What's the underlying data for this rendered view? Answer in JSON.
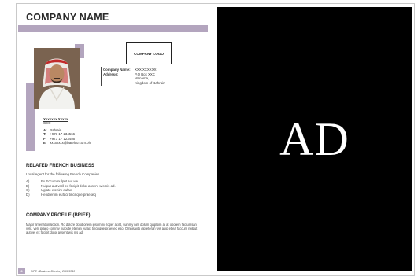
{
  "left_page": {
    "company_name": "COMPANY NAME",
    "logo_label": "COMPANY LOGO",
    "company_info": {
      "company_name_label": "Company Name:",
      "company_name_value": "XXX XXXXXX",
      "address_label": "Address:",
      "address_lines": [
        "P.O Box XXX",
        "Manama,",
        "Kingdom of Bahrain"
      ]
    },
    "contact": {
      "name": "Xxxxxxx Xxxxx",
      "title": "CEO",
      "rows": [
        {
          "key": "A:",
          "value": "Bahrain"
        },
        {
          "key": "T:",
          "value": "+973 17 234566"
        },
        {
          "key": "F:",
          "value": "+973 17 123456"
        },
        {
          "key": "E:",
          "value": "xxxxxxxx@batelco.com.bh"
        }
      ]
    },
    "related_heading": "RELATED FRENCH BUSINESS",
    "related_sub": "Local Agent for the following French Companies",
    "related_items": [
      {
        "key": "A)",
        "value": "Ex Eccum nulput aut we"
      },
      {
        "key": "B)",
        "value": "Nulput aut veril ex facipit dolor assent wis nis ad."
      },
      {
        "key": "C)",
        "value": "Ugiate etenim eufaci"
      },
      {
        "key": "D)",
        "value": "Hendrenim eufaci tincilique praeseq"
      }
    ],
    "profile_heading": "COMPANY PROFILE (BRIEF):",
    "profile_text": "Major fimenationalction. Ro dolore dolobonem ipsummo loper acilit, summy nim dolum quiplsim at at oborem facrumsan velit, velit praeo commy nulpute etenim eufaci tincilique praeseq eso. Omnisaiito dip eteran wis adip et ea faccum nulput aut vel ex facipit dolor assent wis nis ad.",
    "page_number": "8",
    "footer_text": "CIPE - Business Directory 2009/2010"
  },
  "right_page": {
    "ad_text": "AD"
  },
  "colors": {
    "accent": "#b3a5be",
    "ad_background": "#000000",
    "ad_text": "#ffffff"
  }
}
